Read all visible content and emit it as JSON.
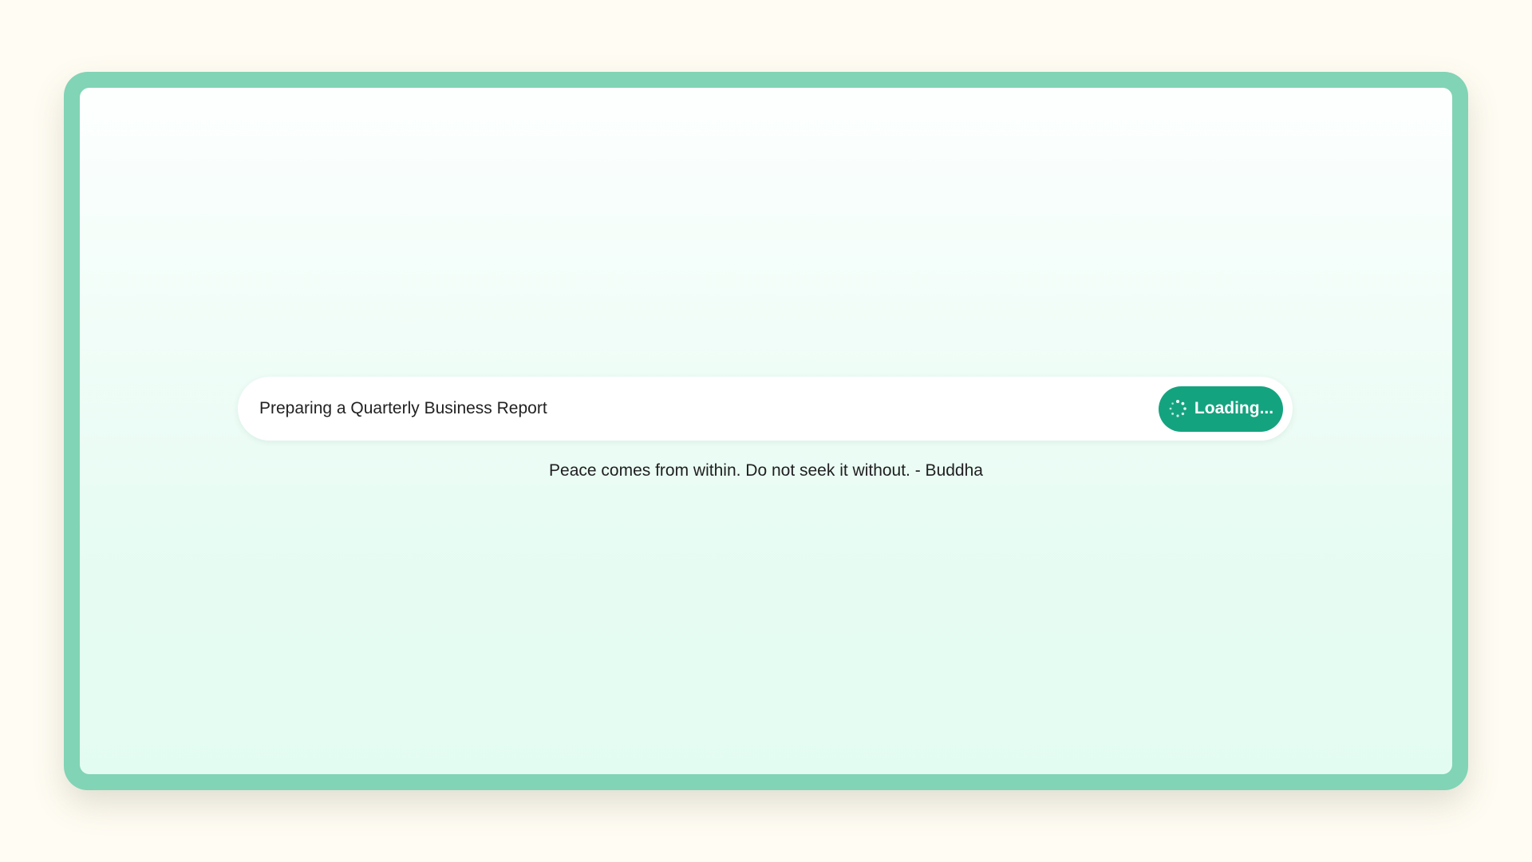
{
  "search": {
    "value": "Preparing a Quarterly Business Report",
    "placeholder": ""
  },
  "button": {
    "label": "Loading...",
    "icon": "spinner-icon"
  },
  "quote": {
    "text": "Peace comes from within. Do not seek it without. - Buddha"
  },
  "colors": {
    "page_background": "#fffcf3",
    "frame": "#81d4b5",
    "accent": "#14a37f",
    "panel_top": "#fdfffe",
    "panel_bottom": "#e3fcf1"
  }
}
